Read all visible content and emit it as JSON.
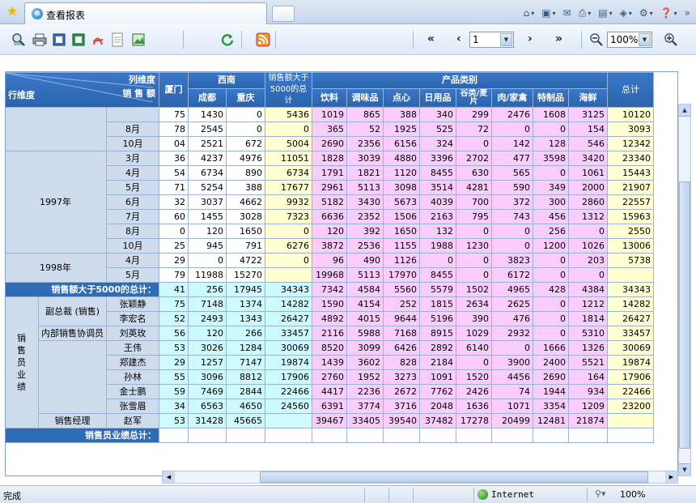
{
  "tab": {
    "title": "查看报表"
  },
  "toolbar": {
    "page_value": "1",
    "zoom_value": "100%",
    "nav_first": "«",
    "nav_prev": "‹",
    "nav_next": "›",
    "nav_last": "»"
  },
  "header": {
    "col_dim_label": "列维度",
    "sales_label": "销 售 额",
    "row_dim_label": "行维度",
    "xiamen": "厦门",
    "region_southwest": "西南",
    "chengdu": "成都",
    "chongqing": "重庆",
    "over5000_line1": "销售额大于",
    "over5000_line2": "5000的总计",
    "product_category": "产品类别",
    "total": "总计",
    "products": [
      "饮料",
      "调味品",
      "点心",
      "日用品",
      "谷类/麦片",
      "肉/家禽",
      "特制品",
      "海鲜"
    ]
  },
  "rows": [
    {
      "group": "",
      "sub": "",
      "xm": "75",
      "cd": "1430",
      "cq": "0",
      "ov": "5436",
      "p": [
        "1019",
        "865",
        "388",
        "340",
        "299",
        "2476",
        "1608",
        "3125"
      ],
      "tot": "10120"
    },
    {
      "group": "",
      "sub": "8月",
      "xm": "78",
      "cd": "2545",
      "cq": "0",
      "ov": "0",
      "p": [
        "365",
        "52",
        "1925",
        "525",
        "72",
        "0",
        "0",
        "154"
      ],
      "tot": "3093"
    },
    {
      "group": "",
      "sub": "10月",
      "xm": "04",
      "cd": "2521",
      "cq": "672",
      "ov": "5004",
      "p": [
        "2690",
        "2356",
        "6156",
        "324",
        "0",
        "142",
        "128",
        "546"
      ],
      "tot": "12342"
    },
    {
      "group": "1997年",
      "sub": "3月",
      "xm": "36",
      "cd": "4237",
      "cq": "4976",
      "ov": "11051",
      "p": [
        "1828",
        "3039",
        "4880",
        "3396",
        "2702",
        "477",
        "3598",
        "3420"
      ],
      "tot": "23340"
    },
    {
      "group": "",
      "sub": "4月",
      "xm": "54",
      "cd": "6734",
      "cq": "890",
      "ov": "6734",
      "p": [
        "1791",
        "1821",
        "1120",
        "8455",
        "630",
        "565",
        "0",
        "1061"
      ],
      "tot": "15443"
    },
    {
      "group": "",
      "sub": "5月",
      "xm": "71",
      "cd": "5254",
      "cq": "388",
      "ov": "17677",
      "p": [
        "2961",
        "5113",
        "3098",
        "3514",
        "4281",
        "590",
        "349",
        "2000"
      ],
      "tot": "21907"
    },
    {
      "group": "",
      "sub": "6月",
      "xm": "32",
      "cd": "3037",
      "cq": "4662",
      "ov": "9932",
      "p": [
        "5182",
        "3430",
        "5673",
        "4039",
        "700",
        "372",
        "300",
        "2860"
      ],
      "tot": "22557"
    },
    {
      "group": "",
      "sub": "7月",
      "xm": "60",
      "cd": "1455",
      "cq": "3028",
      "ov": "7323",
      "p": [
        "6636",
        "2352",
        "1506",
        "2163",
        "795",
        "743",
        "456",
        "1312"
      ],
      "tot": "15963"
    },
    {
      "group": "",
      "sub": "8月",
      "xm": "0",
      "cd": "120",
      "cq": "1650",
      "ov": "0",
      "p": [
        "120",
        "392",
        "1650",
        "132",
        "0",
        "0",
        "256",
        "0"
      ],
      "tot": "2550"
    },
    {
      "group": "",
      "sub": "10月",
      "xm": "25",
      "cd": "945",
      "cq": "791",
      "ov": "6276",
      "p": [
        "3872",
        "2536",
        "1155",
        "1988",
        "1230",
        "0",
        "1200",
        "1026"
      ],
      "tot": "13006"
    },
    {
      "group": "1998年",
      "sub": "4月",
      "xm": "29",
      "cd": "0",
      "cq": "4722",
      "ov": "0",
      "p": [
        "96",
        "490",
        "1126",
        "0",
        "0",
        "3823",
        "0",
        "203"
      ],
      "tot": "5738"
    },
    {
      "group": "",
      "sub": "5月",
      "xm": "79",
      "cd": "11988",
      "cq": "15270",
      "ov": "",
      "p": [
        "19968",
        "5113",
        "17970",
        "8455",
        "0",
        "6172",
        "0",
        "0"
      ],
      "tot": ""
    }
  ],
  "sum_row_1": {
    "label": "销售额大于5000的总计：",
    "xm": "41",
    "cd": "256",
    "cq": "17945",
    "ov": "34343",
    "p": [
      "7342",
      "4584",
      "5560",
      "5579",
      "1502",
      "4965",
      "428",
      "4384"
    ],
    "tot": "34343"
  },
  "sales_group_label": "销售员业绩",
  "staff_rows": [
    {
      "role": "副总裁 (销售)",
      "name": "张颖静",
      "xm": "75",
      "cd": "7148",
      "cq": "1374",
      "ov": "14282",
      "p": [
        "1590",
        "4154",
        "252",
        "1815",
        "2634",
        "2625",
        "0",
        "1212"
      ],
      "tot": "14282"
    },
    {
      "role": "",
      "name": "李宏名",
      "xm": "52",
      "cd": "2493",
      "cq": "1343",
      "ov": "26427",
      "p": [
        "4892",
        "4015",
        "9644",
        "5196",
        "390",
        "476",
        "0",
        "1814"
      ],
      "tot": "26427"
    },
    {
      "role": "内部销售协调员",
      "name": "刘英玫",
      "xm": "56",
      "cd": "120",
      "cq": "266",
      "ov": "33457",
      "p": [
        "2116",
        "5988",
        "7168",
        "8915",
        "1029",
        "2932",
        "0",
        "5310"
      ],
      "tot": "33457"
    },
    {
      "role": "",
      "name": "王伟",
      "xm": "53",
      "cd": "3026",
      "cq": "1284",
      "ov": "30069",
      "p": [
        "8520",
        "3099",
        "6426",
        "2892",
        "6140",
        "0",
        "1666",
        "1326"
      ],
      "tot": "30069"
    },
    {
      "role": "销售代表",
      "name": "郑建杰",
      "xm": "29",
      "cd": "1257",
      "cq": "7147",
      "ov": "19874",
      "p": [
        "1439",
        "3602",
        "828",
        "2184",
        "0",
        "3900",
        "2400",
        "5521"
      ],
      "tot": "19874"
    },
    {
      "role": "",
      "name": "孙林",
      "xm": "55",
      "cd": "3096",
      "cq": "8812",
      "ov": "17906",
      "p": [
        "2760",
        "1952",
        "3273",
        "1091",
        "1520",
        "4456",
        "2690",
        "164"
      ],
      "tot": "17906"
    },
    {
      "role": "",
      "name": "金士鹏",
      "xm": "59",
      "cd": "7469",
      "cq": "2844",
      "ov": "22466",
      "p": [
        "4417",
        "2236",
        "2672",
        "7762",
        "2426",
        "74",
        "1944",
        "934"
      ],
      "tot": "22466"
    },
    {
      "role": "",
      "name": "张雪眉",
      "xm": "34",
      "cd": "6563",
      "cq": "4650",
      "ov": "24560",
      "p": [
        "6391",
        "3774",
        "3716",
        "2048",
        "1636",
        "1071",
        "3354",
        "1209"
      ],
      "tot": "23200"
    },
    {
      "role": "销售经理",
      "name": "赵军",
      "xm": "53",
      "cd": "31428",
      "cq": "45665",
      "ov": "",
      "p": [
        "39467",
        "33405",
        "39540",
        "37482",
        "17278",
        "20499",
        "12481",
        "21874"
      ],
      "tot": ""
    }
  ],
  "sum_row_2": {
    "label": "销售员业绩总计："
  },
  "status": {
    "text": "完成",
    "zone": "Internet",
    "zoom": "100%"
  }
}
